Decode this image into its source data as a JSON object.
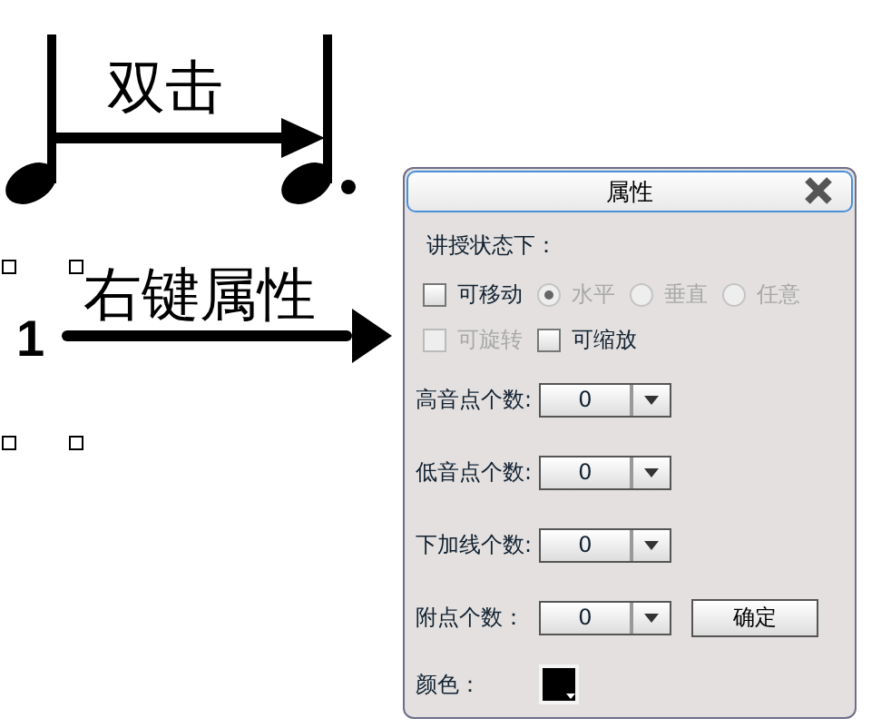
{
  "canvas": {
    "annotations": [
      {
        "label": "双击"
      },
      {
        "label": "右键属性"
      }
    ],
    "digit": "1"
  },
  "dialog": {
    "title": "属性",
    "section_label": "讲授状态下：",
    "options": [
      [
        {
          "kind": "checkbox",
          "label": "可移动",
          "checked": false,
          "disabled": false
        },
        {
          "kind": "radio",
          "label": "水平",
          "selected": true,
          "disabled": true
        },
        {
          "kind": "radio",
          "label": "垂直",
          "selected": false,
          "disabled": true
        },
        {
          "kind": "radio",
          "label": "任意",
          "selected": false,
          "disabled": true
        }
      ],
      [
        {
          "kind": "checkbox",
          "label": "可旋转",
          "checked": false,
          "disabled": true
        },
        {
          "kind": "checkbox",
          "label": "可缩放",
          "checked": false,
          "disabled": false
        }
      ]
    ],
    "fields": [
      {
        "label": "高音点个数:",
        "value": "0"
      },
      {
        "label": "低音点个数:",
        "value": "0"
      },
      {
        "label": "下加线个数:",
        "value": "0"
      },
      {
        "label": "附点个数：",
        "value": "0",
        "button": "确定"
      }
    ],
    "color_label": "颜色：",
    "color": "#000000"
  }
}
